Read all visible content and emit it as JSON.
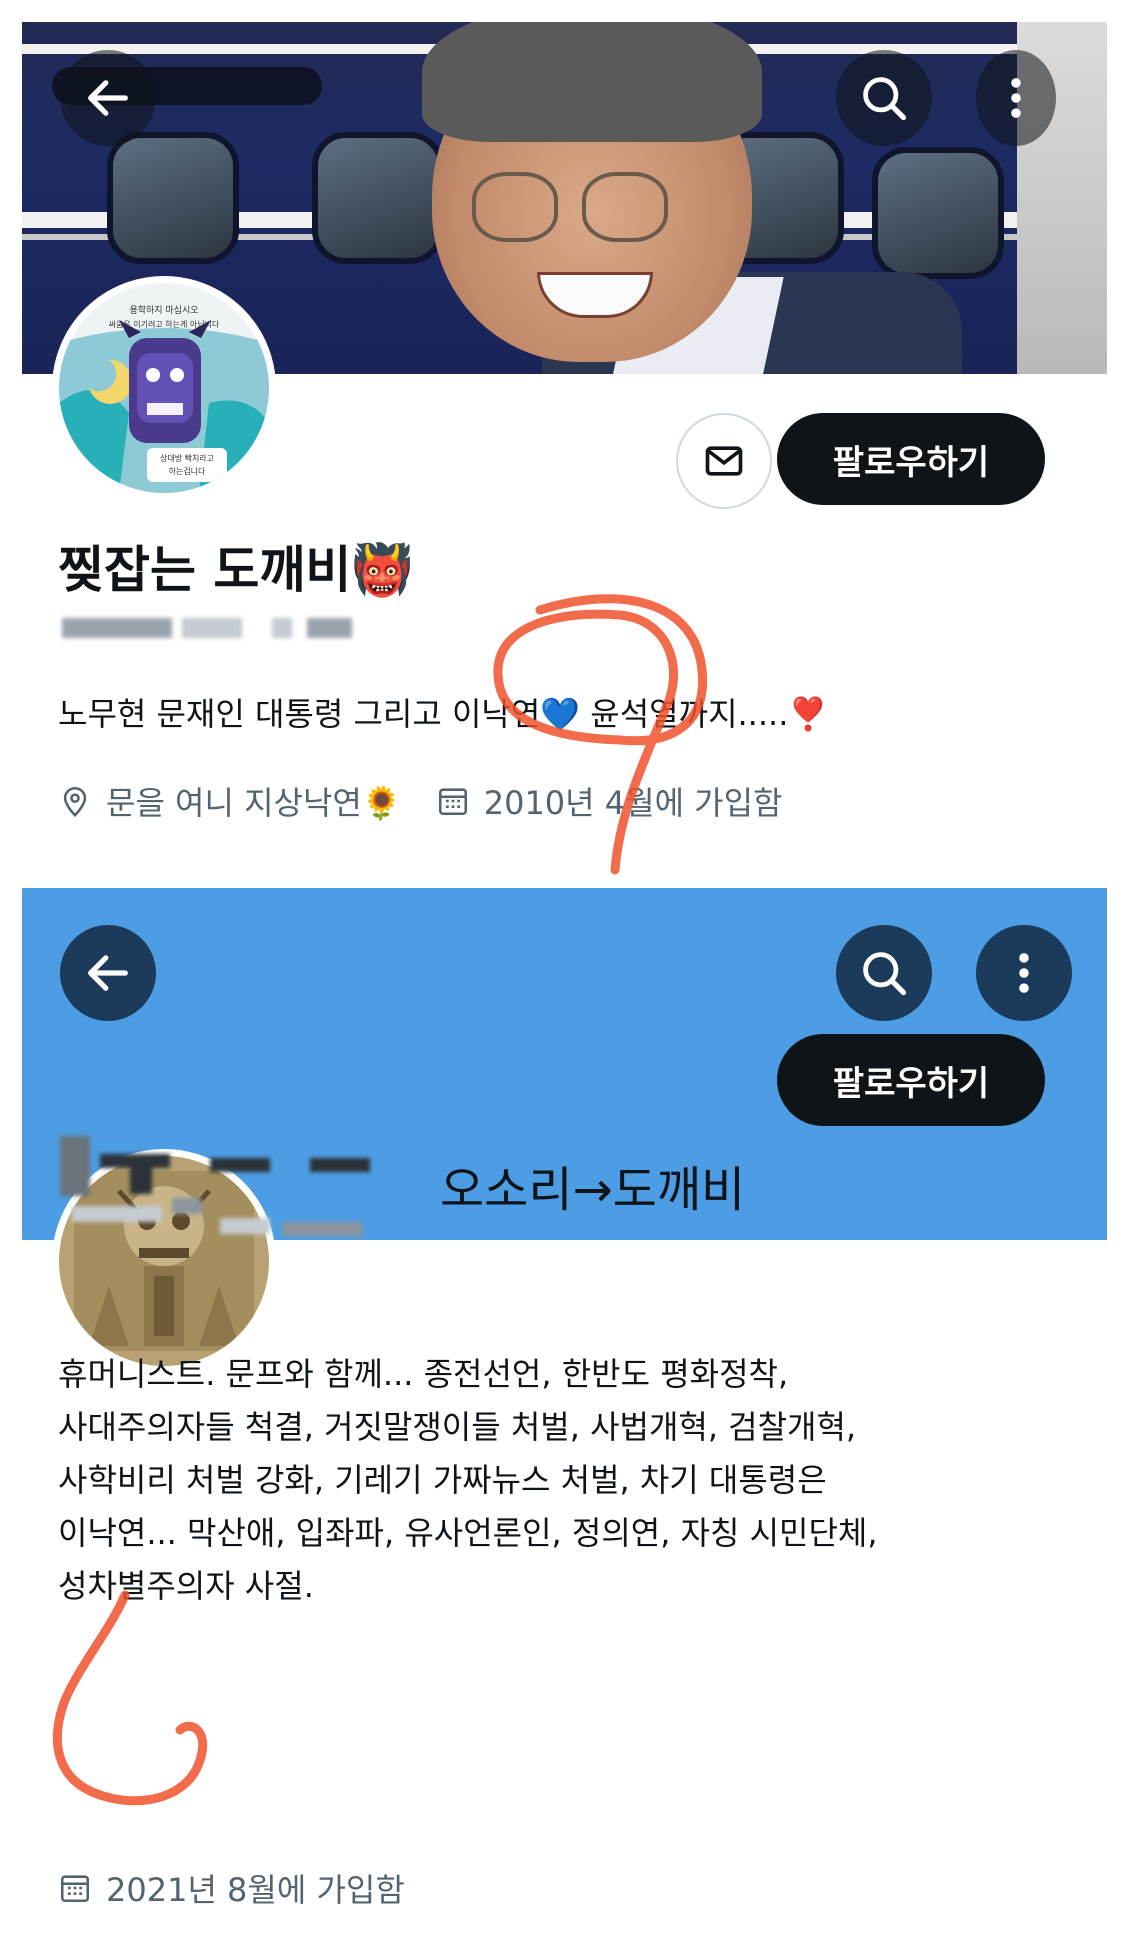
{
  "profiles": [
    {
      "display_name": "찢잡는 도깨비👹",
      "follow_label": "팔로우하기",
      "bio": "노무현 문재인 대통령 그리고 이낙연💙 윤석열까지.....❣️",
      "location": "문을 여니 지상낙연🌻",
      "joined": "2010년 4월에 가입함",
      "avatar_text_top": "귀찮게 구시니 용학하지 마십시오 싸움은 이기려고 하는게 아닙니다",
      "avatar_text_bottom": "상대방 빡치라고 하는겁니다"
    },
    {
      "display_name": "오소리→도깨비",
      "follow_label": "팔로우하기",
      "bio_lines": [
        "휴머니스트. 문프와 함께... 종전선언, 한반도 평화정착,",
        "사대주의자들 척결, 거짓말쟁이들 처벌, 사법개혁, 검찰개혁,",
        "사학비리 처벌 강화, 기레기 가짜뉴스 처벌, 차기 대통령은",
        "이낙연... 막산애, 입좌파, 유사언론인, 정의연, 자칭 시민단체,",
        "성차별주의자 사절."
      ],
      "joined": "2021년 8월에 가입함"
    }
  ],
  "icons": {
    "back": "arrow-left-icon",
    "search": "search-icon",
    "more": "more-vertical-icon",
    "message": "envelope-icon",
    "location": "location-pin-icon",
    "calendar": "calendar-icon"
  },
  "colors": {
    "banner2": "#4c9de3",
    "follow_bg": "#0f1419",
    "meta_text": "#536471",
    "annotation": "#f0512a"
  }
}
